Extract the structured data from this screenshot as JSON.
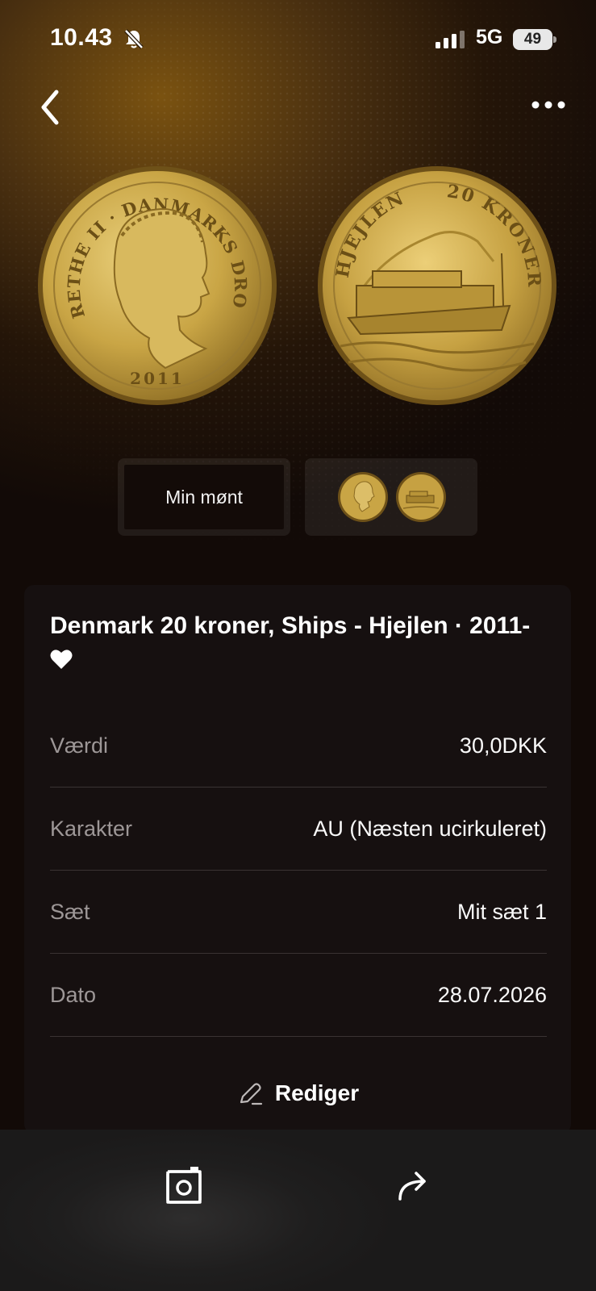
{
  "status_bar": {
    "time": "10.43",
    "network": "5G",
    "battery": "49"
  },
  "coin": {
    "obverse_legend": "MARGRETHE II · DANMARKS DRONNING",
    "obverse_year": "2011",
    "reverse_legend": "HJEJLEN",
    "reverse_denomination": "20 KRONER"
  },
  "image_selector": {
    "mine_label": "Min mønt"
  },
  "details": {
    "title": "Denmark 20 kroner, Ships - Hjejlen · 2011-",
    "rows": [
      {
        "label": "Værdi",
        "value": "30,0DKK"
      },
      {
        "label": "Karakter",
        "value": "AU (Næsten ucirkuleret)"
      },
      {
        "label": "Sæt",
        "value": "Mit sæt 1"
      },
      {
        "label": "Dato",
        "value": "28.07.2026"
      }
    ],
    "edit_label": "Rediger"
  },
  "icons": {
    "status": [
      "bell-muted-icon",
      "signal-bars-icon",
      "battery-icon"
    ],
    "nav": [
      "back-chevron-icon",
      "more-dots-icon"
    ],
    "title": "heart-icon",
    "edit": "pencil-icon",
    "bottom_bar": [
      "camera-icon",
      "share-arrow-icon"
    ]
  },
  "colors": {
    "gold_glow": "#7a5210",
    "background_dark": "#120a07",
    "card_bg": "#161010",
    "label_grey": "#9d9797",
    "coin_gold": "#c9a545"
  }
}
